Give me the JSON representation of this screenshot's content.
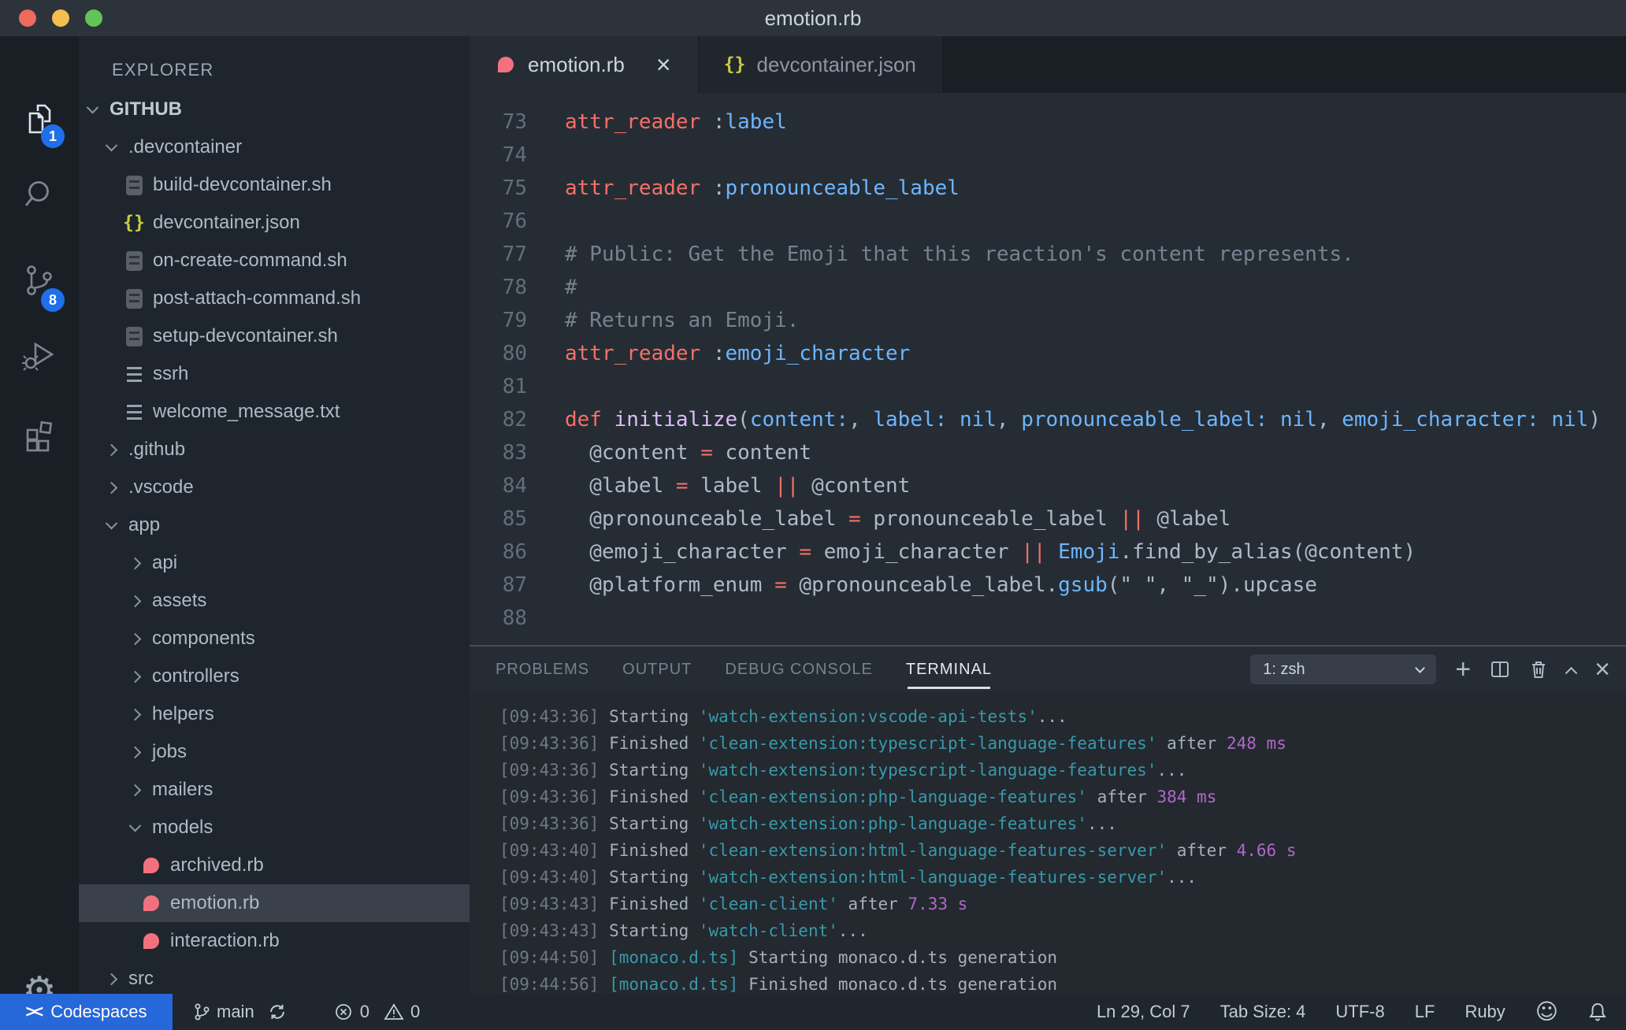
{
  "colors": {
    "accent_blue": "#2667d9",
    "badge_blue": "#1f6feb",
    "ruby_pink": "#f3717f",
    "json_yellow": "#cbcb41",
    "keyword_red": "#f47067",
    "function_purple": "#dcbdfb",
    "variable_blue": "#6cb6ff",
    "comment_gray": "#768390",
    "terminal_cyan": "#3899ab",
    "terminal_magenta": "#b167c9",
    "selection_row": "#3a414b"
  },
  "titlebar": {
    "title": "emotion.rb"
  },
  "activity_bar": {
    "explorer_badge": "1",
    "scm_badge": "8"
  },
  "sidebar": {
    "header": "EXPLORER",
    "tree": [
      {
        "label": "GITHUB",
        "pad": 12,
        "chev": "down",
        "root": true
      },
      {
        "label": ".devcontainer",
        "pad": 36,
        "chev": "down"
      },
      {
        "label": "build-devcontainer.sh",
        "pad": 58,
        "icon": "sh"
      },
      {
        "label": "devcontainer.json",
        "pad": 58,
        "icon": "json"
      },
      {
        "label": "on-create-command.sh",
        "pad": 58,
        "icon": "sh"
      },
      {
        "label": "post-attach-command.sh",
        "pad": 58,
        "icon": "sh"
      },
      {
        "label": "setup-devcontainer.sh",
        "pad": 58,
        "icon": "sh"
      },
      {
        "label": "ssrh",
        "pad": 58,
        "icon": "txt"
      },
      {
        "label": "welcome_message.txt",
        "pad": 58,
        "icon": "txt"
      },
      {
        "label": ".github",
        "pad": 36,
        "chev": "right"
      },
      {
        "label": ".vscode",
        "pad": 36,
        "chev": "right"
      },
      {
        "label": "app",
        "pad": 36,
        "chev": "down"
      },
      {
        "label": "api",
        "pad": 66,
        "chev": "right"
      },
      {
        "label": "assets",
        "pad": 66,
        "chev": "right"
      },
      {
        "label": "components",
        "pad": 66,
        "chev": "right"
      },
      {
        "label": "controllers",
        "pad": 66,
        "chev": "right"
      },
      {
        "label": "helpers",
        "pad": 66,
        "chev": "right"
      },
      {
        "label": "jobs",
        "pad": 66,
        "chev": "right"
      },
      {
        "label": "mailers",
        "pad": 66,
        "chev": "right"
      },
      {
        "label": "models",
        "pad": 66,
        "chev": "down"
      },
      {
        "label": "archived.rb",
        "pad": 80,
        "icon": "ruby"
      },
      {
        "label": "emotion.rb",
        "pad": 80,
        "icon": "ruby",
        "selected": true
      },
      {
        "label": "interaction.rb",
        "pad": 80,
        "icon": "ruby"
      },
      {
        "label": "src",
        "pad": 36,
        "chev": "right"
      }
    ]
  },
  "editor_tabs": [
    {
      "label": "emotion.rb",
      "icon": "ruby",
      "active": true,
      "close": "×"
    },
    {
      "label": "devcontainer.json",
      "icon": "json",
      "active": false
    }
  ],
  "editor": {
    "lines": [
      {
        "n": "73",
        "t": [
          [
            "kw",
            "attr_reader"
          ],
          [
            "txt",
            " :"
          ],
          [
            "var",
            "label"
          ]
        ]
      },
      {
        "n": "74",
        "t": []
      },
      {
        "n": "75",
        "t": [
          [
            "kw",
            "attr_reader"
          ],
          [
            "txt",
            " :"
          ],
          [
            "var",
            "pronounceable_label"
          ]
        ]
      },
      {
        "n": "76",
        "t": []
      },
      {
        "n": "77",
        "t": [
          [
            "com",
            "# Public: Get the Emoji that this reaction's content represents."
          ]
        ]
      },
      {
        "n": "78",
        "t": [
          [
            "com",
            "#"
          ]
        ]
      },
      {
        "n": "79",
        "t": [
          [
            "com",
            "# Returns an Emoji."
          ]
        ]
      },
      {
        "n": "80",
        "t": [
          [
            "kw",
            "attr_reader"
          ],
          [
            "txt",
            " :"
          ],
          [
            "var",
            "emoji_character"
          ]
        ]
      },
      {
        "n": "81",
        "t": []
      },
      {
        "n": "82",
        "t": [
          [
            "kw",
            "def"
          ],
          [
            "txt",
            " "
          ],
          [
            "fn",
            "initialize"
          ],
          [
            "txt",
            "("
          ],
          [
            "var",
            "content:"
          ],
          [
            "txt",
            ", "
          ],
          [
            "var",
            "label:"
          ],
          [
            "txt",
            " "
          ],
          [
            "var",
            "nil"
          ],
          [
            "txt",
            ", "
          ],
          [
            "var",
            "pronounceable_label:"
          ],
          [
            "txt",
            " "
          ],
          [
            "var",
            "nil"
          ],
          [
            "txt",
            ", "
          ],
          [
            "var",
            "emoji_character:"
          ],
          [
            "txt",
            " "
          ],
          [
            "var",
            "nil"
          ],
          [
            "txt",
            ")"
          ]
        ]
      },
      {
        "n": "83",
        "t": [
          [
            "txt",
            "  @content "
          ],
          [
            "kw",
            "="
          ],
          [
            "txt",
            " content"
          ]
        ]
      },
      {
        "n": "84",
        "t": [
          [
            "txt",
            "  @label "
          ],
          [
            "kw",
            "="
          ],
          [
            "txt",
            " label "
          ],
          [
            "kw",
            "||"
          ],
          [
            "txt",
            " @content"
          ]
        ]
      },
      {
        "n": "85",
        "t": [
          [
            "txt",
            "  @pronounceable_label "
          ],
          [
            "kw",
            "="
          ],
          [
            "txt",
            " pronounceable_label "
          ],
          [
            "kw",
            "||"
          ],
          [
            "txt",
            " @label"
          ]
        ]
      },
      {
        "n": "86",
        "t": [
          [
            "txt",
            "  @emoji_character "
          ],
          [
            "kw",
            "="
          ],
          [
            "txt",
            " emoji_character "
          ],
          [
            "kw",
            "||"
          ],
          [
            "txt",
            " "
          ],
          [
            "var",
            "Emoji"
          ],
          [
            "txt",
            ".find_by_alias(@content)"
          ]
        ]
      },
      {
        "n": "87",
        "t": [
          [
            "txt",
            "  @platform_enum "
          ],
          [
            "kw",
            "="
          ],
          [
            "txt",
            " @pronounceable_label."
          ],
          [
            "var",
            "gsub"
          ],
          [
            "txt",
            "(\" \", \"_\").upcase"
          ]
        ]
      },
      {
        "n": "88",
        "t": []
      }
    ]
  },
  "panel": {
    "tabs": [
      {
        "label": "PROBLEMS",
        "active": false
      },
      {
        "label": "OUTPUT",
        "active": false
      },
      {
        "label": "DEBUG CONSOLE",
        "active": false
      },
      {
        "label": "TERMINAL",
        "active": true
      }
    ],
    "shell_selector": "1: zsh",
    "actions": [
      "new-terminal",
      "split-terminal",
      "kill-terminal",
      "maximize-panel",
      "close-panel"
    ]
  },
  "terminal": {
    "lines": [
      {
        "p": [
          [
            "ts",
            "[09:43:36]"
          ],
          [
            "txt",
            " Starting "
          ],
          [
            "cyan",
            "'watch-extension:vscode-api-tests'"
          ],
          [
            "txt",
            "..."
          ]
        ]
      },
      {
        "p": [
          [
            "ts",
            "[09:43:36]"
          ],
          [
            "txt",
            " Finished "
          ],
          [
            "cyan",
            "'clean-extension:typescript-language-features'"
          ],
          [
            "txt",
            " after "
          ],
          [
            "mag",
            "248 ms"
          ]
        ]
      },
      {
        "p": [
          [
            "ts",
            "[09:43:36]"
          ],
          [
            "txt",
            " Starting "
          ],
          [
            "cyan",
            "'watch-extension:typescript-language-features'"
          ],
          [
            "txt",
            "..."
          ]
        ]
      },
      {
        "p": [
          [
            "ts",
            "[09:43:36]"
          ],
          [
            "txt",
            " Finished "
          ],
          [
            "cyan",
            "'clean-extension:php-language-features'"
          ],
          [
            "txt",
            " after "
          ],
          [
            "mag",
            "384 ms"
          ]
        ]
      },
      {
        "p": [
          [
            "ts",
            "[09:43:36]"
          ],
          [
            "txt",
            " Starting "
          ],
          [
            "cyan",
            "'watch-extension:php-language-features'"
          ],
          [
            "txt",
            "..."
          ]
        ]
      },
      {
        "p": [
          [
            "ts",
            "[09:43:40]"
          ],
          [
            "txt",
            " Finished "
          ],
          [
            "cyan",
            "'clean-extension:html-language-features-server'"
          ],
          [
            "txt",
            " after "
          ],
          [
            "mag",
            "4.66 s"
          ]
        ]
      },
      {
        "p": [
          [
            "ts",
            "[09:43:40]"
          ],
          [
            "txt",
            " Starting "
          ],
          [
            "cyan",
            "'watch-extension:html-language-features-server'"
          ],
          [
            "txt",
            "..."
          ]
        ]
      },
      {
        "p": [
          [
            "ts",
            "[09:43:43]"
          ],
          [
            "txt",
            " Finished "
          ],
          [
            "cyan",
            "'clean-client'"
          ],
          [
            "txt",
            " after "
          ],
          [
            "mag",
            "7.33 s"
          ]
        ]
      },
      {
        "p": [
          [
            "ts",
            "[09:43:43]"
          ],
          [
            "txt",
            " Starting "
          ],
          [
            "cyan",
            "'watch-client'"
          ],
          [
            "txt",
            "..."
          ]
        ]
      },
      {
        "p": [
          [
            "ts",
            "[09:44:50]"
          ],
          [
            "txt",
            " "
          ],
          [
            "cyan",
            "[monaco.d.ts]"
          ],
          [
            "txt",
            " Starting monaco.d.ts generation"
          ]
        ]
      },
      {
        "p": [
          [
            "ts",
            "[09:44:56]"
          ],
          [
            "txt",
            " "
          ],
          [
            "cyan",
            "[monaco.d.ts]"
          ],
          [
            "txt",
            " Finished monaco.d.ts generation"
          ]
        ]
      }
    ]
  },
  "statusbar": {
    "remote": "Codespaces",
    "branch": "main",
    "errors": "0",
    "warnings": "0",
    "line_col": "Ln 29, Col 7",
    "tab_size": "Tab Size: 4",
    "encoding": "UTF-8",
    "eol": "LF",
    "language": "Ruby"
  }
}
